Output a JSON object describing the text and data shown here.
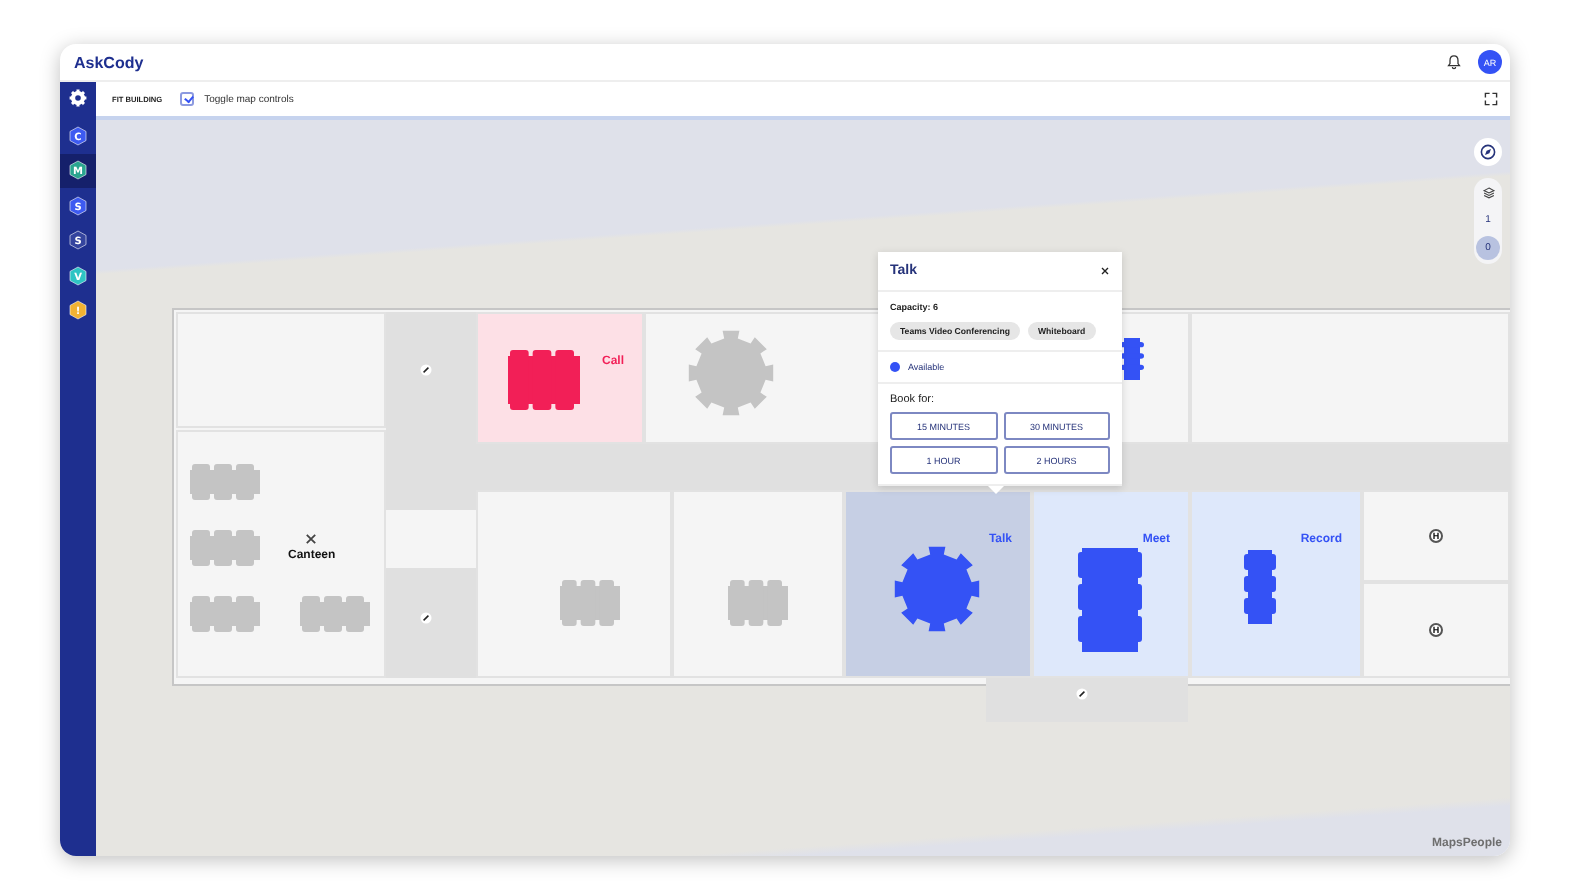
{
  "header": {
    "logo": "AskCody",
    "avatar": "AR"
  },
  "sidebar": {
    "items": [
      {
        "letter": "C",
        "color": "#3d5af1",
        "selected": false
      },
      {
        "letter": "M",
        "color": "#2aa58f",
        "selected": true
      },
      {
        "letter": "S",
        "color": "#3d5af1",
        "selected": false
      },
      {
        "letter": "S",
        "color": "#34449e",
        "selected": false
      },
      {
        "letter": "V",
        "color": "#2ec4c4",
        "selected": false
      },
      {
        "letter": "!",
        "color": "#f2b233",
        "selected": false
      }
    ]
  },
  "toolbar": {
    "fit_label": "FIT BUILDING",
    "toggle": {
      "label": "Toggle map controls",
      "checked": true
    }
  },
  "map": {
    "rooms": [
      {
        "color": "#f5f5f5"
      },
      {
        "color": "#f5f5f5",
        "label": "Canteen"
      },
      {
        "color": "#fde0e6",
        "label": "Call"
      },
      {
        "color": "#f5f5f5"
      },
      {
        "color": "#f5f5f5"
      },
      {
        "color": "#f5f5f5"
      },
      {
        "color": "#f5f5f5"
      },
      {
        "color": "#c6cfe4",
        "label": "Talk"
      },
      {
        "color": "#dee8fb",
        "label": "Meet"
      },
      {
        "color": "#dee8fb",
        "label": "Record"
      },
      {
        "color": "#f5f5f5",
        "marker": "H"
      },
      {
        "color": "#f5f5f5",
        "marker": "H"
      }
    ],
    "tables": [
      {
        "color": "#f21f57"
      },
      {
        "color": "#c4c4c4"
      },
      {
        "color": "#3452f5"
      },
      {
        "color": "#c4c4c4"
      },
      {
        "color": "#c4c4c4"
      },
      {
        "color": "#c4c4c4"
      },
      {
        "color": "#c4c4c4"
      },
      {
        "color": "#c4c4c4"
      },
      {
        "color": "#c4c4c4"
      },
      {
        "color": "#3452f5"
      },
      {
        "color": "#3452f5"
      },
      {
        "color": "#3452f5"
      }
    ],
    "floors": [
      {
        "label": "1",
        "selected": false
      },
      {
        "label": "0",
        "selected": true
      }
    ],
    "attribution": "MapsPeople"
  },
  "popup": {
    "title": "Talk",
    "capacity": "Capacity: 6",
    "tags": [
      "Teams Video Conferencing",
      "Whiteboard"
    ],
    "status": {
      "label": "Available",
      "color": "#3452f5"
    },
    "book_label": "Book for:",
    "options": [
      "15 MINUTES",
      "30 MINUTES",
      "1 HOUR",
      "2 HOURS"
    ]
  }
}
